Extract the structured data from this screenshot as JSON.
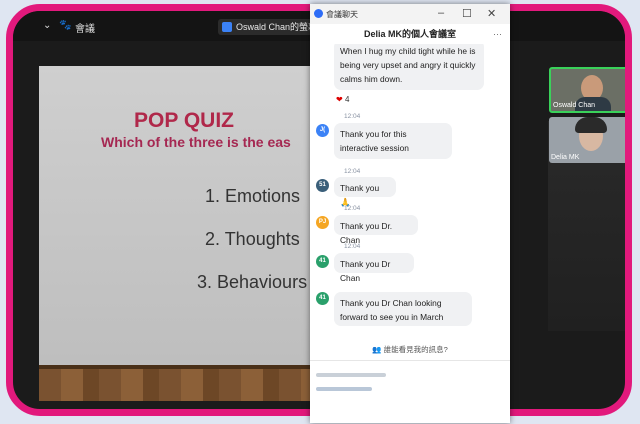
{
  "window": {
    "meeting_label": "會議",
    "share_label": "Oswald Chan的螢幕"
  },
  "slide": {
    "title": "POP QUIZ",
    "subtitle": "Which of the three is the eas",
    "options": [
      "1. Emotions",
      "2. Thoughts",
      "3. Behaviours"
    ]
  },
  "chat": {
    "app_title": "會議聊天",
    "header": "Delia MK的個人會議室",
    "more_label": "···",
    "messages": [
      {
        "text": "When I hug my child tight while he is being very upset and angry it quickly calms him down."
      },
      {
        "time": "12:04",
        "avatar": "J(",
        "avatar_color": "#3b82f6",
        "text": "Thank you for this interactive session"
      },
      {
        "time": "12:04",
        "avatar": "51",
        "avatar_color": "#3a5f7a",
        "text": "Thank you 🙏"
      },
      {
        "time": "12:04",
        "avatar": "PJ",
        "avatar_color": "#f5a623",
        "text": "Thank you Dr. Chan"
      },
      {
        "time": "12:04",
        "avatar": "41",
        "avatar_color": "#2aa06b",
        "text": "Thank you Dr Chan"
      },
      {
        "avatar": "41",
        "avatar_color": "#2aa06b",
        "text": "Thank you Dr Chan looking forward to see you in March"
      }
    ],
    "reaction": {
      "emoji": "❤",
      "count": "4"
    },
    "prompt": "誰能看見我的訊息?"
  },
  "gallery": {
    "tiles": [
      {
        "name": "Oswald Chan"
      },
      {
        "name": "Delia MK"
      }
    ]
  },
  "colors": {
    "frame_accent": "#e2197c",
    "slide_title": "#b0284a",
    "active_speaker_border": "#3ad15a"
  }
}
